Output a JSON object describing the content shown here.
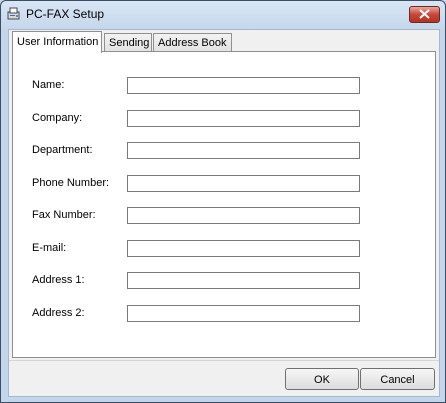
{
  "window": {
    "title": "PC-FAX Setup",
    "icons": {
      "app": "fax-app-icon",
      "close": "close-icon"
    }
  },
  "tabs": [
    {
      "label": "User Information",
      "active": true
    },
    {
      "label": "Sending",
      "active": false
    },
    {
      "label": "Address Book",
      "active": false
    }
  ],
  "form": {
    "fields": [
      {
        "label": "Name:",
        "value": ""
      },
      {
        "label": "Company:",
        "value": ""
      },
      {
        "label": "Department:",
        "value": ""
      },
      {
        "label": "Phone Number:",
        "value": ""
      },
      {
        "label": "Fax Number:",
        "value": ""
      },
      {
        "label": "E-mail:",
        "value": ""
      },
      {
        "label": "Address 1:",
        "value": ""
      },
      {
        "label": "Address 2:",
        "value": ""
      }
    ]
  },
  "buttons": {
    "ok": "OK",
    "cancel": "Cancel"
  },
  "colors": {
    "titlebar": "#c4d6ec",
    "close_button": "#c7463a",
    "panel": "#ffffff"
  }
}
